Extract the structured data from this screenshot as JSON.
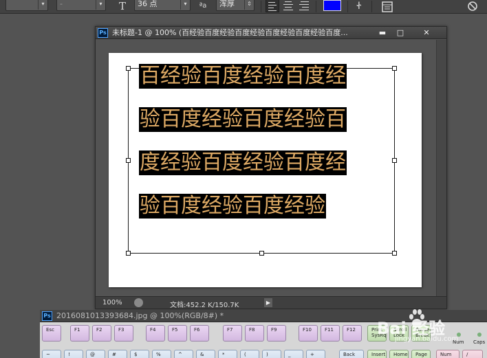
{
  "options_bar": {
    "font_style_value": "-",
    "font_size_value": "36 点",
    "antialias_value": "浑厚",
    "text_orientation_icon": "text-orientation-icon",
    "font_size_icon": "font-size-icon",
    "antialias_icon": "antialias-icon",
    "align_icons": [
      "align-left-icon",
      "align-center-icon",
      "align-right-icon"
    ],
    "text_color": "#0000ff",
    "warp_icon": "warp-text-icon",
    "panels_icon": "character-panel-icon",
    "cancel_icon": "cancel-icon"
  },
  "document": {
    "badge": "Ps",
    "title": "未标题-1 @ 100% (百经验百度经验百度经验百度经验百度经验百度...",
    "minimize": "▬",
    "maximize": "□",
    "close": "✕",
    "text_lines": [
      "百经验百度经验百度经",
      "验百度经验百度经验百",
      "度经验百度经验百度经",
      "验百度经验百度经验"
    ],
    "status_zoom": "100%",
    "status_info": "文档:452.2 K/150.7K",
    "status_arrow": "▶"
  },
  "second_document": {
    "badge": "Ps",
    "title": "20160810133936​84.jpg @ 100%(RGB/8#) *"
  },
  "keyboard": {
    "row1": [
      "Esc",
      "F1",
      "F2",
      "F3",
      "F4",
      "F5",
      "F6",
      "F7",
      "F8",
      "F9",
      "F10",
      "F11",
      "F12",
      "Print\nSysRq",
      "Scroll\nLock",
      "Pause\nBreak"
    ],
    "row2": [
      "~",
      "!",
      "@",
      "#",
      "$",
      "%",
      "^",
      "&",
      "*",
      "(",
      ")",
      "_",
      "+",
      "Back"
    ],
    "leds": [
      "Num",
      "Caps"
    ],
    "bottom_right": [
      "Insert",
      "Home",
      "Page",
      "Num",
      "/"
    ]
  },
  "watermark": {
    "brand": "Bai 经验",
    "url": "jingyan.baidu.com"
  },
  "colors": {
    "text_fill": "#dda964",
    "text_highlight": "#000000",
    "workspace": "#535353"
  }
}
